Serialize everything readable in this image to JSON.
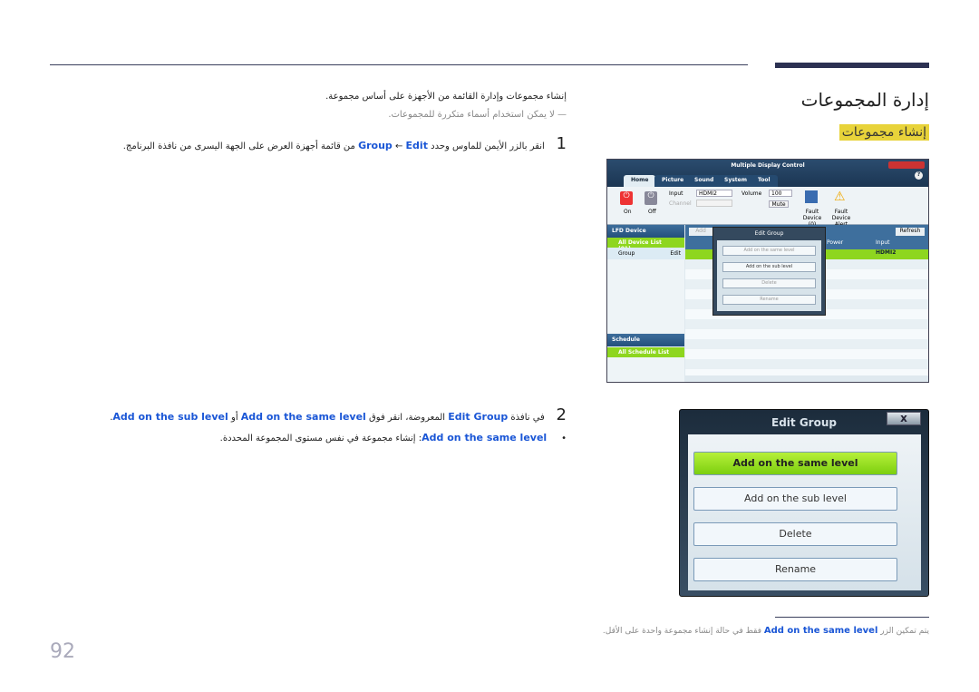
{
  "header": {
    "title": "إدارة المجموعات",
    "section": "إنشاء مجموعات"
  },
  "intro": "إنشاء مجموعات وإدارة القائمة من الأجهزة على أساس مجموعة.",
  "note": "لا يمكن استخدام أسماء متكررة للمجموعات.",
  "step1": {
    "num": "1",
    "a": "انقر بالزر الأيمن للماوس وحدد",
    "edit": "Edit",
    "arrow": "←",
    "group": "Group",
    "b": "من قائمة أجهزة العرض على الجهة اليسرى من نافذة البرنامج."
  },
  "step2": {
    "num": "2",
    "a": "في نافذة",
    "edit_group": "Edit Group",
    "b": "المعروضة، انقر فوق",
    "same": "Add on the same level",
    "or": "أو",
    "sub": "Add on the sub level",
    "end": "."
  },
  "bullet": {
    "term": "Add on the same level",
    "colon": ":",
    "text": "إنشاء مجموعة في نفس مستوى المجموعة المحددة."
  },
  "footnote": {
    "a": "يتم تمكين الزر",
    "term": "Add on the same level",
    "b": "فقط في حالة إنشاء مجموعة واحدة على الأقل."
  },
  "page_number": "92",
  "app": {
    "title": "Multiple Display Control",
    "tabs": [
      "Home",
      "Picture",
      "Sound",
      "System",
      "Tool"
    ],
    "input_label": "Input",
    "input_value": "HDMI2",
    "channel_label": "Channel",
    "volume_label": "Volume",
    "volume_value": "100",
    "mute": "Mute",
    "on": "On",
    "off": "Off",
    "fault_device": "Fault Device (0)",
    "fault_alert": "Fault Device Alert",
    "lfd_device": "LFD Device",
    "all_device_list": "All Device List (01)",
    "group": "Group",
    "edit": "Edit",
    "schedule": "Schedule",
    "all_schedule": "All Schedule List",
    "add": "Add",
    "refresh": "Refresh",
    "col_power": "Power",
    "col_input": "Input",
    "row_input": "HDMI2"
  },
  "dialog": {
    "title": "Edit Group",
    "close": "x",
    "buttons": [
      "Add on the same level",
      "Add on the sub level",
      "Delete",
      "Rename"
    ]
  }
}
